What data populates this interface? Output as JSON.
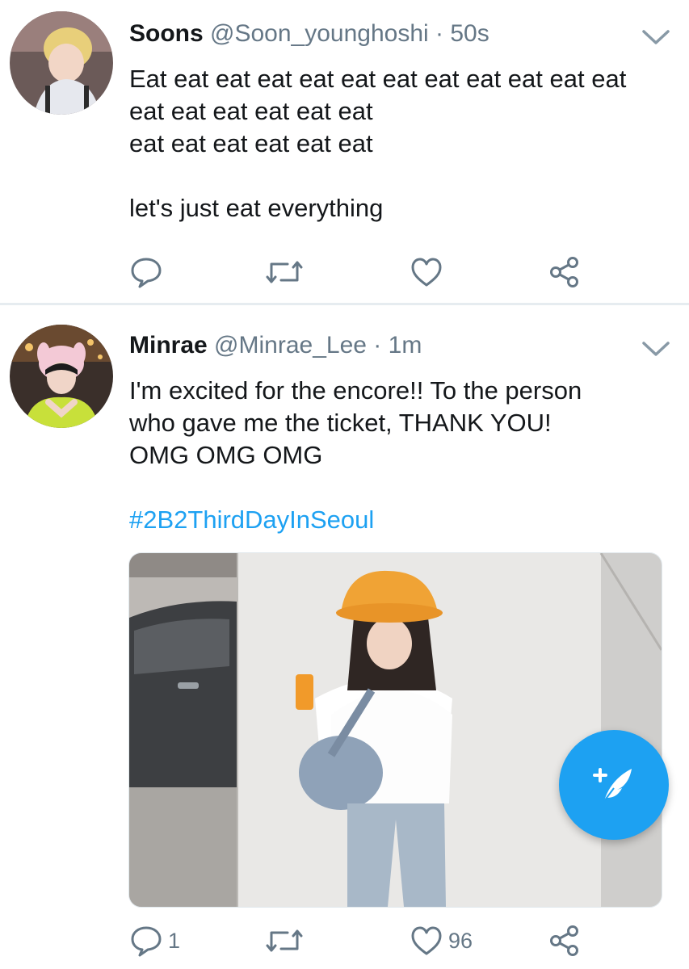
{
  "tweets": [
    {
      "name": "Soons",
      "handle": "@Soon_younghoshi",
      "separator": "·",
      "time": "50s",
      "lines": [
        "Eat eat eat eat eat eat eat eat eat eat eat eat",
        "eat eat eat eat eat eat",
        "eat eat eat eat eat eat",
        "",
        "let's just eat everything"
      ],
      "avatar_icon": "avatar-photo",
      "actions": {
        "reply": "",
        "retweet": "",
        "like": ""
      }
    },
    {
      "name": "Minrae",
      "handle": "@Minrae_Lee",
      "separator": "·",
      "time": "1m",
      "lines": [
        "I'm excited for the encore!! To the person",
        "who gave me the ticket, THANK YOU!",
        "OMG OMG OMG"
      ],
      "hashtag": "#2B2ThirdDayInSeoul",
      "avatar_icon": "avatar-photo",
      "media_icon": "photo-girl-orange-bucket-hat",
      "actions": {
        "reply": "1",
        "retweet": "",
        "like": "96"
      }
    }
  ],
  "compose_button_icon": "compose-tweet-icon",
  "colors": {
    "accent": "#1da1f2",
    "secondary_text": "#657786",
    "divider": "#e6ecf0"
  }
}
